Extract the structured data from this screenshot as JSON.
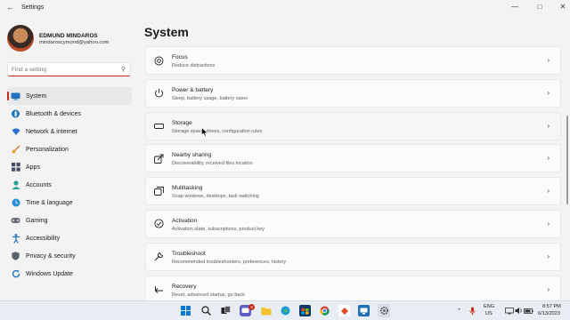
{
  "window": {
    "title": "Settings"
  },
  "profile": {
    "name": "EDMUND MINDAROS",
    "email": "mindaroscymond@yahoo.com"
  },
  "search": {
    "placeholder": "Find a setting"
  },
  "sidebar": {
    "items": [
      {
        "label": "System",
        "icon": "monitor-icon",
        "color": "#1e73be",
        "selected": true
      },
      {
        "label": "Bluetooth & devices",
        "icon": "bluetooth-icon",
        "color": "#1e73be"
      },
      {
        "label": "Network & internet",
        "icon": "wifi-icon",
        "color": "#2a6fd6"
      },
      {
        "label": "Personalization",
        "icon": "brush-icon",
        "color": "#d9822b"
      },
      {
        "label": "Apps",
        "icon": "apps-icon",
        "color": "#444c66"
      },
      {
        "label": "Accounts",
        "icon": "person-icon",
        "color": "#2aa198"
      },
      {
        "label": "Time & language",
        "icon": "globe-clock-icon",
        "color": "#2a8fd6"
      },
      {
        "label": "Gaming",
        "icon": "gamepad-icon",
        "color": "#666c7a"
      },
      {
        "label": "Accessibility",
        "icon": "accessibility-icon",
        "color": "#1e73be"
      },
      {
        "label": "Privacy & security",
        "icon": "shield-icon",
        "color": "#5a6270"
      },
      {
        "label": "Windows Update",
        "icon": "update-icon",
        "color": "#1e73be"
      }
    ]
  },
  "main": {
    "title": "System",
    "cards": [
      {
        "title": "Focus",
        "subtitle": "Reduce distractions",
        "icon": "focus-icon"
      },
      {
        "title": "Power & battery",
        "subtitle": "Sleep, battery usage, battery saver",
        "icon": "power-icon"
      },
      {
        "title": "Storage",
        "subtitle": "Storage space, drives, configuration rules",
        "icon": "storage-icon"
      },
      {
        "title": "Nearby sharing",
        "subtitle": "Discoverability, received files location",
        "icon": "share-icon"
      },
      {
        "title": "Multitasking",
        "subtitle": "Snap windows, desktops, task switching",
        "icon": "multitask-icon"
      },
      {
        "title": "Activation",
        "subtitle": "Activation state, subscriptions, product key",
        "icon": "activation-icon"
      },
      {
        "title": "Troubleshoot",
        "subtitle": "Recommended troubleshooters, preferences, history",
        "icon": "wrench-icon"
      },
      {
        "title": "Recovery",
        "subtitle": "Reset, advanced startup, go back",
        "icon": "recovery-icon"
      }
    ]
  },
  "taskbar": {
    "language_top": "ENG",
    "language_bottom": "US",
    "time": "8:57 PM",
    "date": "6/13/2023",
    "notification_count": "3",
    "accent": "#0067c0"
  }
}
